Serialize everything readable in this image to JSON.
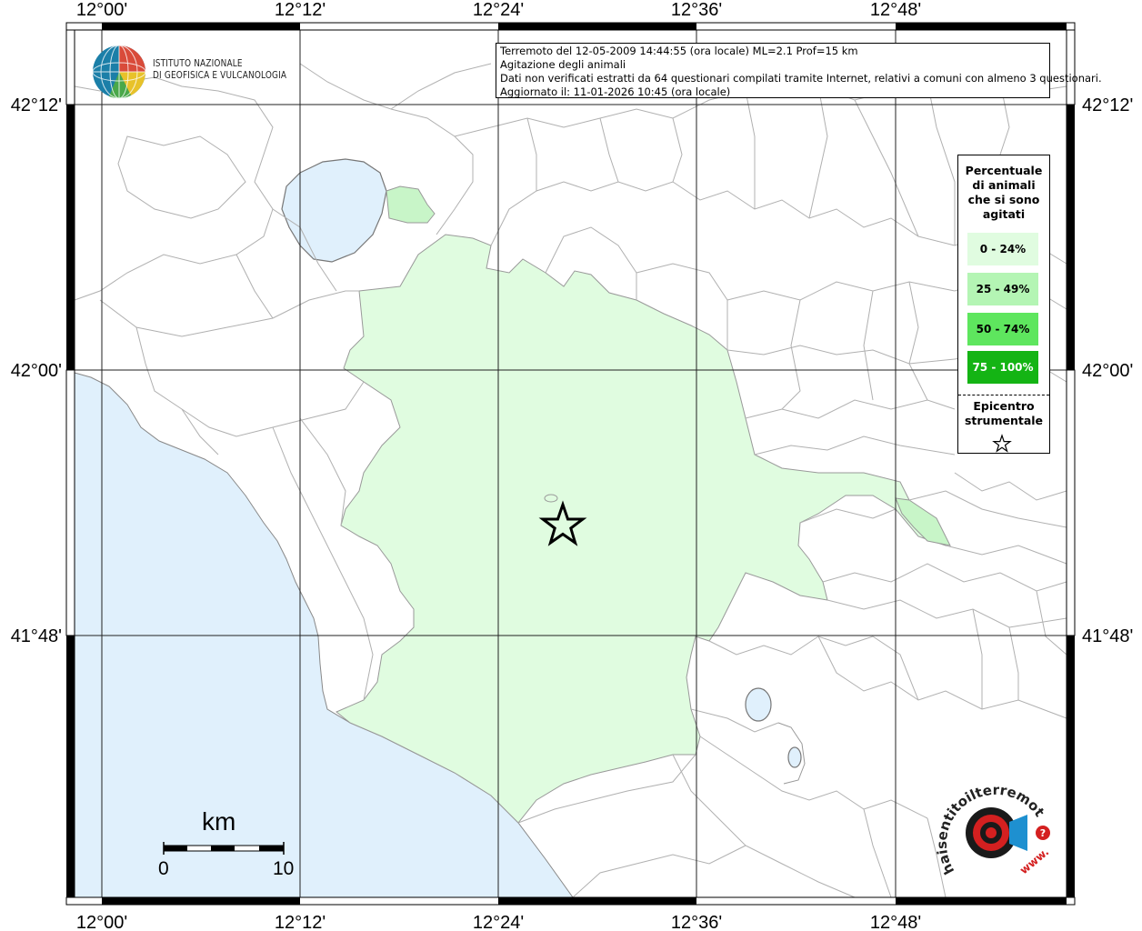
{
  "header": {
    "line1": "Terremoto del 12-05-2009 14:44:55 (ora locale) ML=2.1 Prof=15 km",
    "line2": "Agitazione degli animali",
    "line3": "Dati non verificati estratti da 64 questionari compilati tramite Internet, relativi a comuni con almeno 3 questionari.",
    "line4": "Aggiornato il: 11-01-2026 10:45 (ora locale)"
  },
  "logo": {
    "line1": "ISTITUTO NAZIONALE",
    "line2": "DI GEOFISICA E VULCANOLOGIA"
  },
  "axes": {
    "lon_ticks": [
      "12°00'",
      "12°12'",
      "12°24'",
      "12°36'",
      "12°48'"
    ],
    "lat_ticks": [
      "42°12'",
      "42°00'",
      "41°48'"
    ]
  },
  "legend": {
    "title_lines": [
      "Percentuale",
      "di animali",
      "che si sono",
      "agitati"
    ],
    "items": [
      {
        "label": "0 - 24%",
        "color": "#e0fce0",
        "text_color": "#000000"
      },
      {
        "label": "25 - 49%",
        "color": "#b4f5b4",
        "text_color": "#000000"
      },
      {
        "label": "50 - 74%",
        "color": "#5ee65e",
        "text_color": "#000000"
      },
      {
        "label": "75 - 100%",
        "color": "#14b414",
        "text_color": "#ffffff"
      }
    ],
    "epicenter_lines": [
      "Epicentro",
      "strumentale"
    ]
  },
  "scale": {
    "unit": "km",
    "start": "0",
    "end": "10"
  },
  "watermark": {
    "text": "haisentitoilterremoto.it",
    "prefix": "www."
  },
  "colors": {
    "sea": "#e0f0fc",
    "affected_area": "#e0fce0",
    "affected_area_mid": "#c8f5c8",
    "boundary": "#9a9a9a",
    "grid": "#000000"
  }
}
